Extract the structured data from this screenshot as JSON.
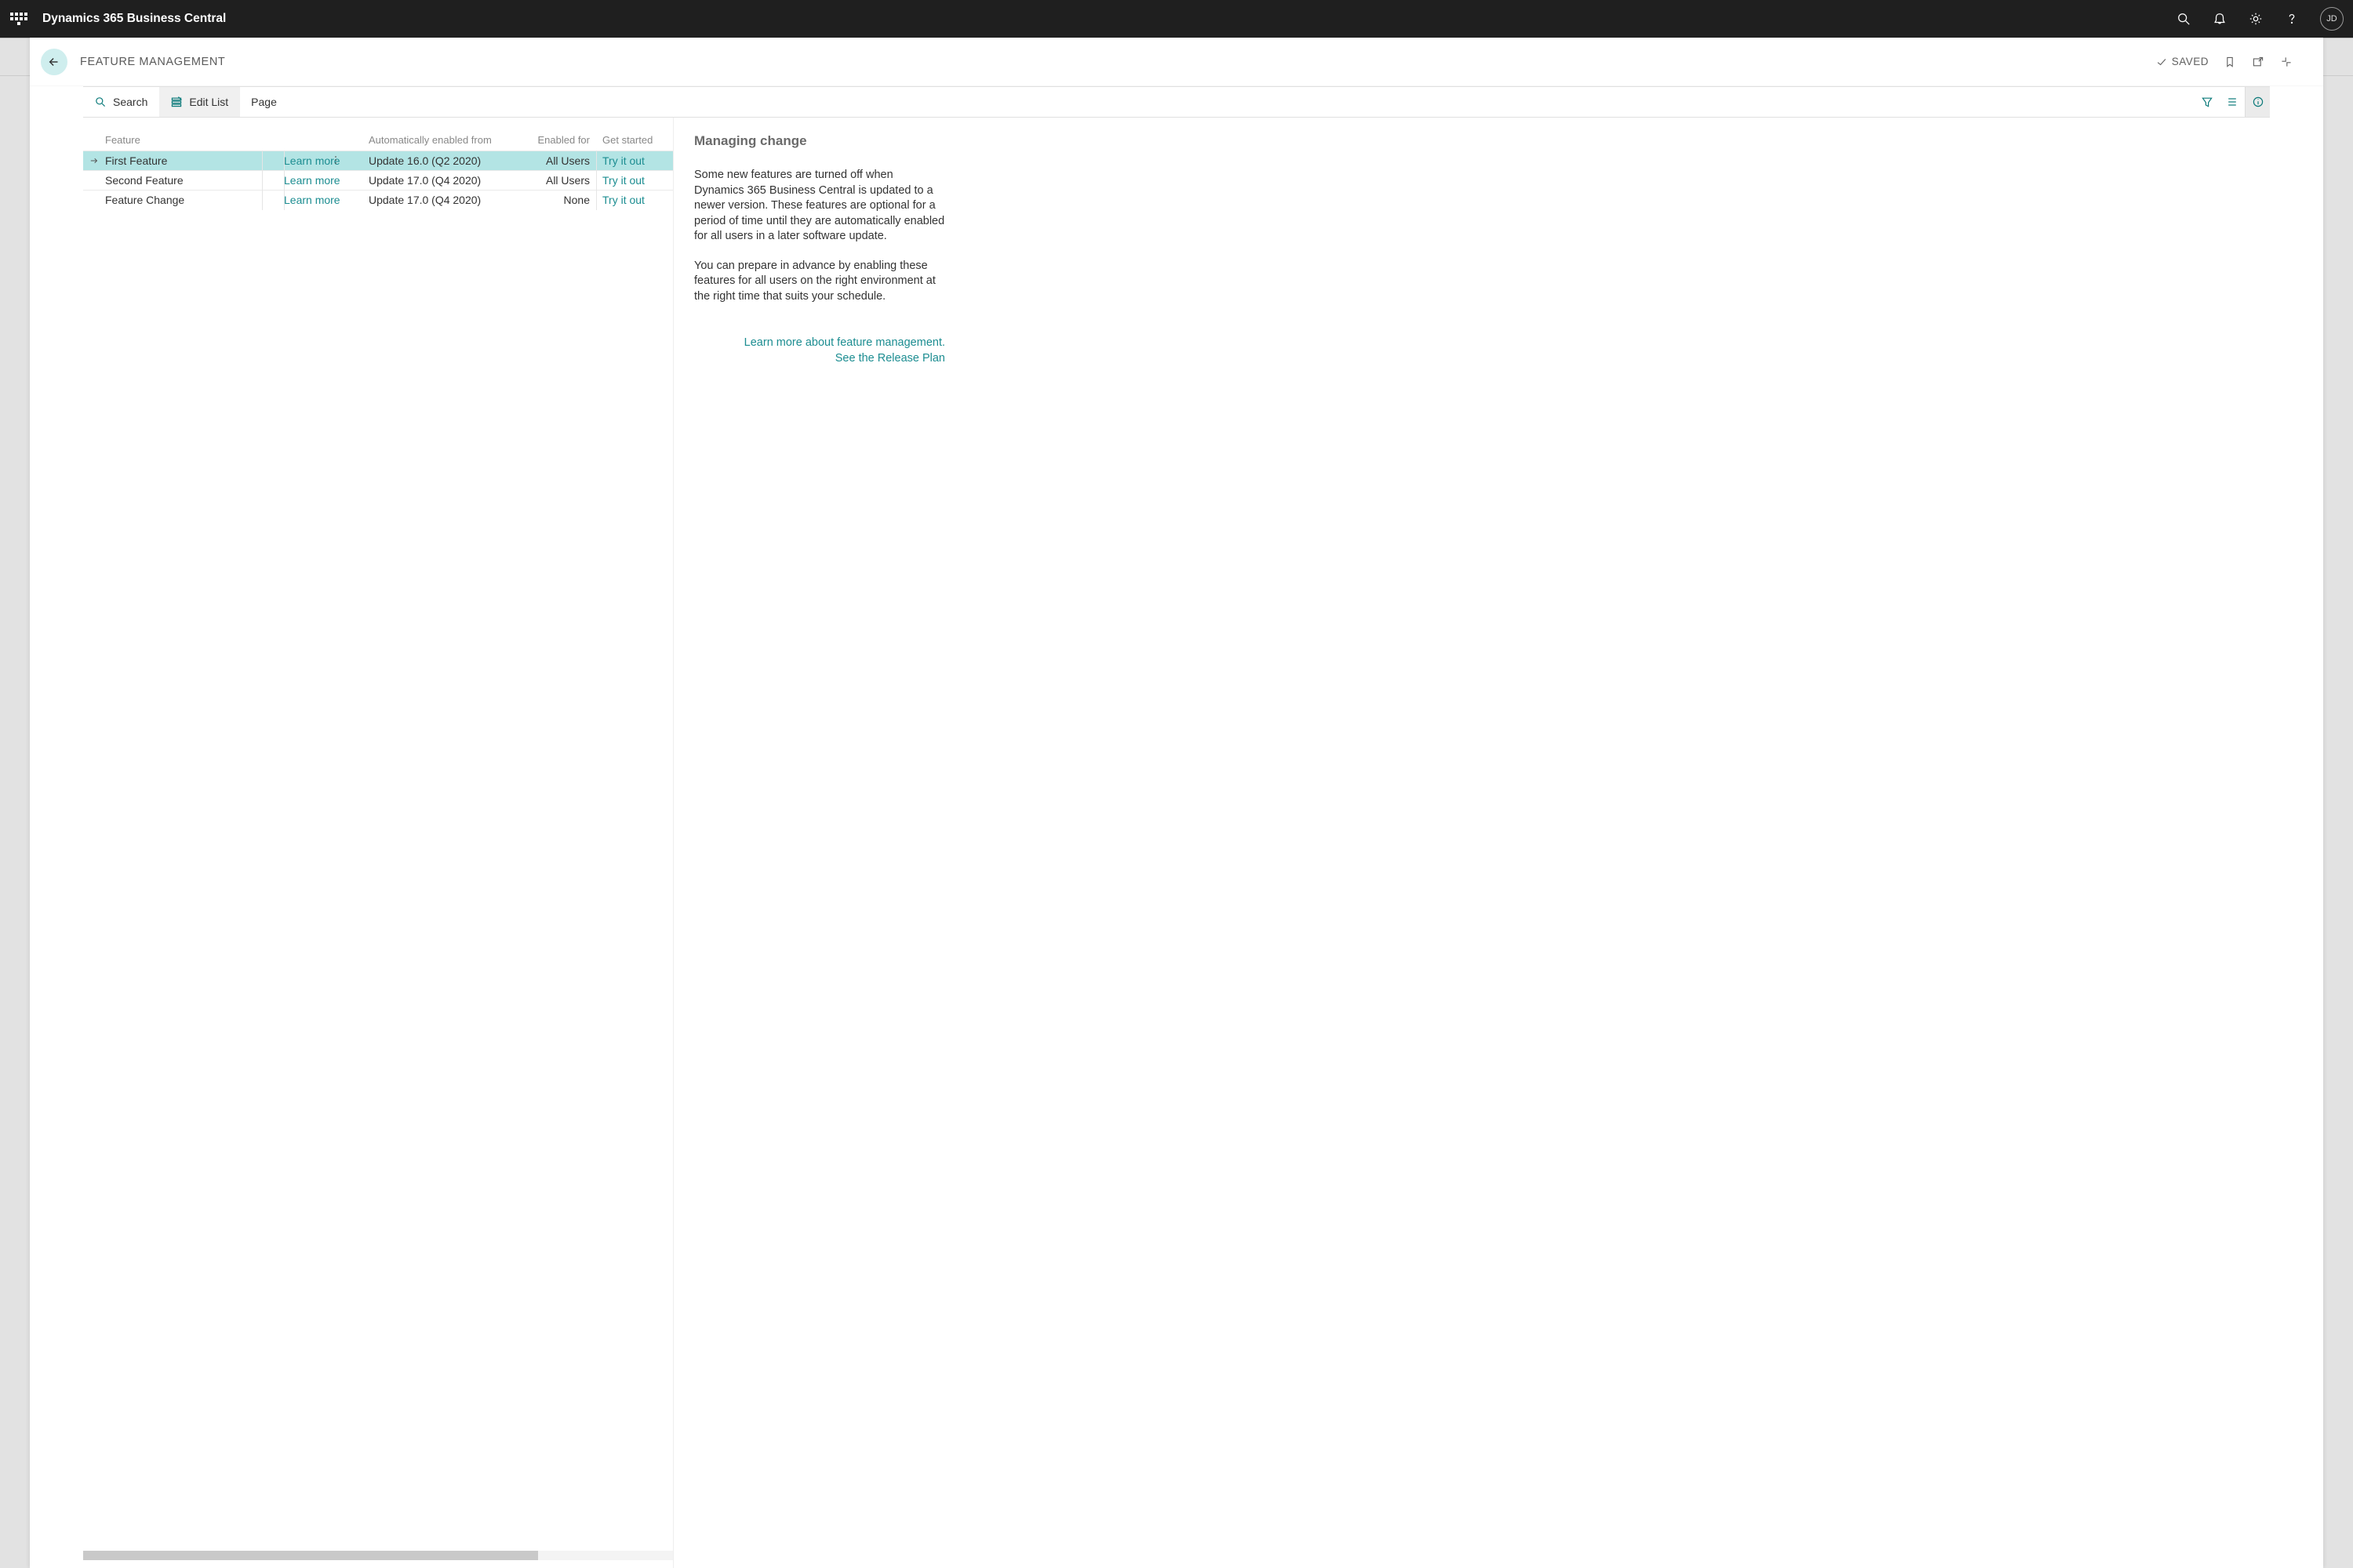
{
  "topbar": {
    "brand": "Dynamics 365 Business Central",
    "avatar_initials": "JD"
  },
  "page": {
    "title": "FEATURE MANAGEMENT",
    "saved_label": "SAVED"
  },
  "ribbon": {
    "search": "Search",
    "edit_list": "Edit List",
    "page": "Page"
  },
  "table": {
    "headers": {
      "feature": "Feature",
      "auto": "Automatically enabled from",
      "enabled_for": "Enabled for",
      "get_started": "Get started"
    },
    "learn_more": "Learn more",
    "try_it_out": "Try it out",
    "rows": [
      {
        "feature": "First Feature",
        "auto": "Update 16.0 (Q2 2020)",
        "enabled_for": "All Users"
      },
      {
        "feature": "Second Feature",
        "auto": "Update 17.0 (Q4 2020)",
        "enabled_for": "All Users"
      },
      {
        "feature": "Feature Change",
        "auto": "Update 17.0 (Q4 2020)",
        "enabled_for": "None"
      }
    ]
  },
  "factbox": {
    "title": "Managing change",
    "para1": "Some new features are turned off when Dynamics 365 Business Central is updated to a newer version. These features are optional for a period of time until they are automatically enabled for all users in a later software update.",
    "para2": "You can prepare in advance by enabling these features for all users on the right environment at the right time that suits your schedule.",
    "link1": "Learn more about feature management.",
    "link2": "See the Release Plan"
  }
}
